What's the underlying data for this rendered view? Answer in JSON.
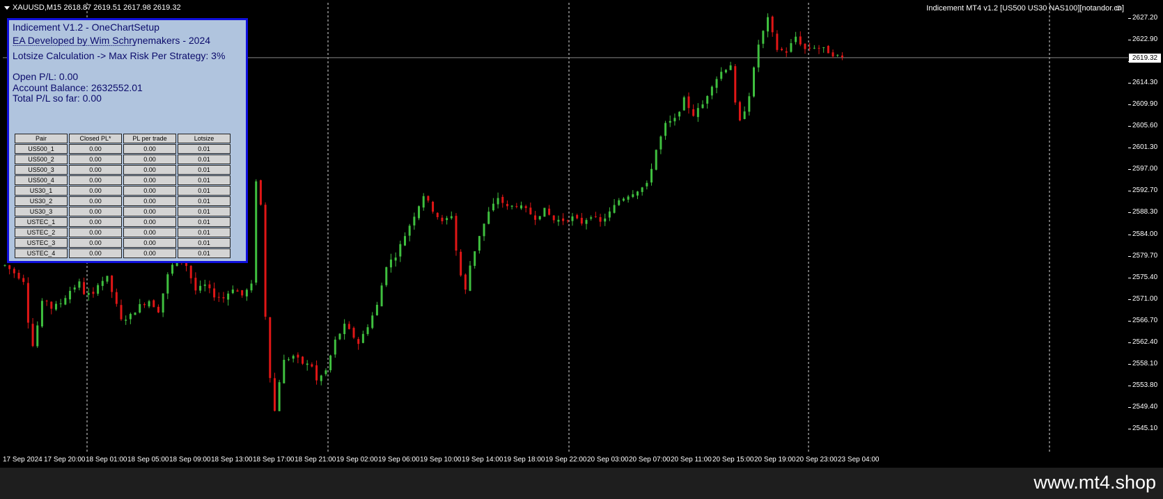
{
  "header": {
    "symbol_line": "XAUUSD,M15  2618.87 2619.51 2617.98 2619.32",
    "indicator_title": "Indicement MT4 v1.2 [US500 US30 NAS100][notandor.cn]"
  },
  "panel": {
    "title": "Indicement V1.2 - OneChartSetup",
    "developer": "EA Developed by Wim Schrynemakers - 2024",
    "separator": "-----------------------------------------------------------",
    "lotsize": "Lotsize Calculation -> Max Risk Per Strategy: 3%",
    "open_pl": "Open P/L: 0.00",
    "balance": "Account Balance: 2632552.01",
    "total_pl": "Total P/L so far: 0.00",
    "table": {
      "headers": [
        "Pair",
        "Closed PL*",
        "PL per trade",
        "Lotsize"
      ],
      "rows": [
        [
          "US500_1",
          "0.00",
          "0.00",
          "0.01"
        ],
        [
          "US500_2",
          "0.00",
          "0.00",
          "0.01"
        ],
        [
          "US500_3",
          "0.00",
          "0.00",
          "0.01"
        ],
        [
          "US500_4",
          "0.00",
          "0.00",
          "0.01"
        ],
        [
          "US30_1",
          "0.00",
          "0.00",
          "0.01"
        ],
        [
          "US30_2",
          "0.00",
          "0.00",
          "0.01"
        ],
        [
          "US30_3",
          "0.00",
          "0.00",
          "0.01"
        ],
        [
          "USTEC_1",
          "0.00",
          "0.00",
          "0.01"
        ],
        [
          "USTEC_2",
          "0.00",
          "0.00",
          "0.01"
        ],
        [
          "USTEC_3",
          "0.00",
          "0.00",
          "0.01"
        ],
        [
          "USTEC_4",
          "0.00",
          "0.00",
          "0.01"
        ]
      ]
    }
  },
  "price_axis": {
    "ticks": [
      "2627.20",
      "2622.90",
      "2618.60",
      "2614.30",
      "2609.90",
      "2605.60",
      "2601.30",
      "2597.00",
      "2592.70",
      "2588.30",
      "2584.00",
      "2579.70",
      "2575.40",
      "2571.00",
      "2566.70",
      "2562.40",
      "2558.10",
      "2553.80",
      "2549.40",
      "2545.10"
    ],
    "current_price": "2619.32"
  },
  "time_axis": {
    "labels": [
      "17 Sep 2024",
      "17 Sep 20:00",
      "18 Sep 01:00",
      "18 Sep 05:00",
      "18 Sep 09:00",
      "18 Sep 13:00",
      "18 Sep 17:00",
      "18 Sep 21:00",
      "19 Sep 02:00",
      "19 Sep 06:00",
      "19 Sep 10:00",
      "19 Sep 14:00",
      "19 Sep 18:00",
      "19 Sep 22:00",
      "20 Sep 03:00",
      "20 Sep 07:00",
      "20 Sep 11:00",
      "20 Sep 15:00",
      "20 Sep 19:00",
      "20 Sep 23:00",
      "23 Sep 04:00"
    ]
  },
  "chart_data": {
    "type": "candlestick",
    "close_path": [
      [
        0,
        2578.0
      ],
      [
        2,
        2576.5
      ],
      [
        4,
        2575.0
      ],
      [
        5,
        2567.0
      ],
      [
        6,
        2562.0
      ],
      [
        7,
        2566.0
      ],
      [
        8,
        2570.5
      ],
      [
        9,
        2571.0
      ],
      [
        10,
        2569.5
      ],
      [
        12,
        2570.5
      ],
      [
        14,
        2573.0
      ],
      [
        16,
        2574.5
      ],
      [
        17,
        2572.5
      ],
      [
        19,
        2572.0
      ],
      [
        20,
        2574.5
      ],
      [
        22,
        2575.5
      ],
      [
        24,
        2570.0
      ],
      [
        25,
        2567.0
      ],
      [
        27,
        2568.0
      ],
      [
        29,
        2570.0
      ],
      [
        31,
        2571.0
      ],
      [
        33,
        2569.0
      ],
      [
        35,
        2576.0
      ],
      [
        37,
        2580.0
      ],
      [
        39,
        2578.0
      ],
      [
        41,
        2573.0
      ],
      [
        43,
        2574.0
      ],
      [
        45,
        2572.0
      ],
      [
        47,
        2571.5
      ],
      [
        49,
        2573.5
      ],
      [
        51,
        2572.0
      ],
      [
        53,
        2574.0
      ],
      [
        54,
        2595.0
      ],
      [
        55,
        2590.0
      ],
      [
        56,
        2568.0
      ],
      [
        57,
        2556.0
      ],
      [
        58,
        2549.0
      ],
      [
        59,
        2555.0
      ],
      [
        60,
        2559.0
      ],
      [
        62,
        2560.0
      ],
      [
        64,
        2558.5
      ],
      [
        66,
        2558.0
      ],
      [
        67,
        2555.0
      ],
      [
        68,
        2556.0
      ],
      [
        69,
        2557.0
      ],
      [
        71,
        2563.0
      ],
      [
        73,
        2566.0
      ],
      [
        74,
        2565.0
      ],
      [
        76,
        2562.5
      ],
      [
        78,
        2566.0
      ],
      [
        80,
        2570.0
      ],
      [
        82,
        2578.0
      ],
      [
        84,
        2580.0
      ],
      [
        86,
        2584.0
      ],
      [
        88,
        2588.0
      ],
      [
        90,
        2592.0
      ],
      [
        92,
        2589.0
      ],
      [
        94,
        2586.5
      ],
      [
        96,
        2588.0
      ],
      [
        97,
        2581.0
      ],
      [
        98,
        2576.0
      ],
      [
        99,
        2573.0
      ],
      [
        100,
        2578.0
      ],
      [
        102,
        2584.0
      ],
      [
        104,
        2588.5
      ],
      [
        106,
        2591.5
      ],
      [
        108,
        2589.5
      ],
      [
        110,
        2590.0
      ],
      [
        112,
        2589.0
      ],
      [
        114,
        2587.5
      ],
      [
        116,
        2589.0
      ],
      [
        118,
        2587.0
      ],
      [
        120,
        2587.0
      ],
      [
        122,
        2587.5
      ],
      [
        124,
        2586.5
      ],
      [
        126,
        2588.0
      ],
      [
        128,
        2586.5
      ],
      [
        130,
        2588.5
      ],
      [
        132,
        2591.0
      ],
      [
        134,
        2592.0
      ],
      [
        136,
        2593.0
      ],
      [
        138,
        2594.0
      ],
      [
        140,
        2601.0
      ],
      [
        142,
        2606.0
      ],
      [
        144,
        2607.0
      ],
      [
        146,
        2611.0
      ],
      [
        148,
        2608.0
      ],
      [
        150,
        2610.0
      ],
      [
        152,
        2614.0
      ],
      [
        154,
        2616.5
      ],
      [
        156,
        2618.0
      ],
      [
        157,
        2610.0
      ],
      [
        158,
        2606.5
      ],
      [
        159,
        2609.0
      ],
      [
        160,
        2612.0
      ],
      [
        161,
        2617.0
      ],
      [
        162,
        2622.0
      ],
      [
        164,
        2627.0
      ],
      [
        166,
        2621.0
      ],
      [
        168,
        2620.5
      ],
      [
        170,
        2623.5
      ],
      [
        172,
        2621.0
      ],
      [
        174,
        2621.5
      ],
      [
        176,
        2621.0
      ],
      [
        178,
        2620.0
      ],
      [
        180,
        2619.3
      ]
    ]
  }
}
